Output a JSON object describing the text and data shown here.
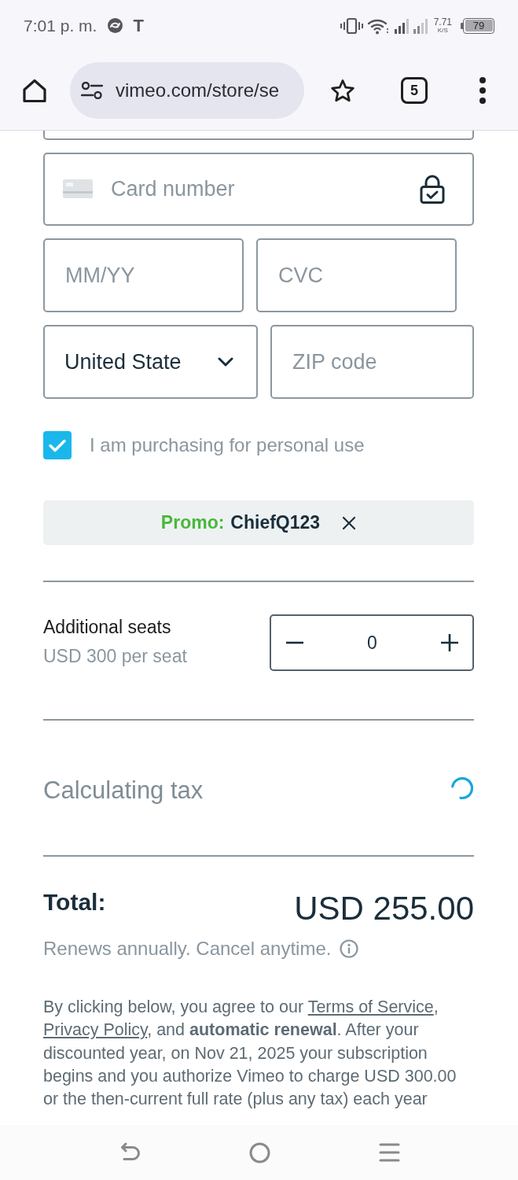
{
  "status_bar": {
    "time": "7:01 p. m.",
    "notification_letter": "T",
    "net_speed": "7.71",
    "net_speed_unit": "K/S",
    "battery": "79"
  },
  "browser": {
    "url": "vimeo.com/store/se",
    "tab_count": "5"
  },
  "payment_form": {
    "card_number": {
      "placeholder": "Card number"
    },
    "expiry": {
      "placeholder": "MM/YY"
    },
    "cvc": {
      "placeholder": "CVC"
    },
    "country": {
      "value": "United State"
    },
    "zip": {
      "placeholder": "ZIP code"
    }
  },
  "personal_use": {
    "label": "I am purchasing for personal use",
    "checked": true
  },
  "promo": {
    "label": "Promo:",
    "code": "ChiefQ123"
  },
  "seats": {
    "title": "Additional seats",
    "price": "USD 300 per seat",
    "count": "0"
  },
  "tax": {
    "label": "Calculating tax",
    "loading": true
  },
  "total": {
    "label": "Total:",
    "amount": "USD 255.00",
    "note": "Renews annually. Cancel anytime."
  },
  "legal": {
    "parts": [
      {
        "kind": "text",
        "text": "By clicking below, you agree to our "
      },
      {
        "kind": "link",
        "text": "Terms of Service"
      },
      {
        "kind": "text",
        "text": ", "
      },
      {
        "kind": "link",
        "text": "Privacy Policy"
      },
      {
        "kind": "text",
        "text": ", and **automatic renewal**. After your discounted year, on Nov 21, 2025 your subscription begins and you authorize Vimeo to charge USD 300.00 or the then-current full rate (plus any tax) each year"
      }
    ]
  }
}
